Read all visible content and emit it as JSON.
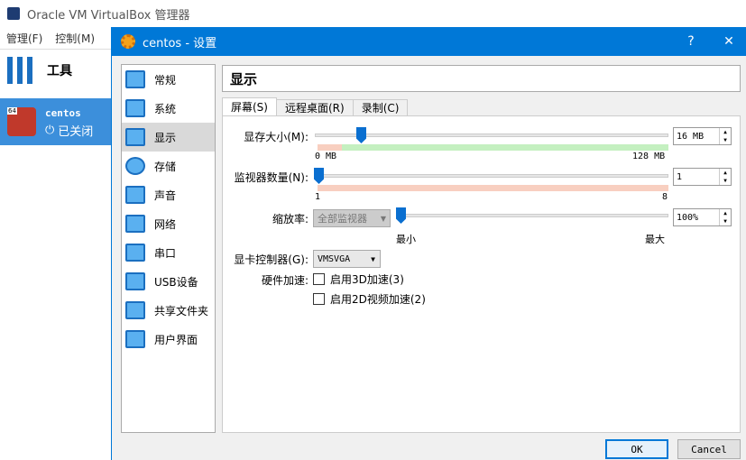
{
  "bg_window": {
    "title": "Oracle VM VirtualBox 管理器",
    "menu": [
      "管理(F)",
      "控制(M)"
    ],
    "tools_label": "工具",
    "vm": {
      "name": "centos",
      "badge": "64",
      "state": "已关闭"
    }
  },
  "dialog": {
    "title": "centos - 设置",
    "help": "?",
    "close": "✕",
    "sidebar": [
      {
        "label": "常规"
      },
      {
        "label": "系统"
      },
      {
        "label": "显示",
        "selected": true
      },
      {
        "label": "存储"
      },
      {
        "label": "声音"
      },
      {
        "label": "网络"
      },
      {
        "label": "串口"
      },
      {
        "label": "USB设备"
      },
      {
        "label": "共享文件夹"
      },
      {
        "label": "用户界面"
      }
    ],
    "header": "显示",
    "tabs": [
      "屏幕(S)",
      "远程桌面(R)",
      "录制(C)"
    ],
    "video_memory": {
      "label": "显存大小(M):",
      "value": "16 MB",
      "min": "0 MB",
      "max": "128 MB",
      "fraction": 0.125
    },
    "monitors": {
      "label": "监视器数量(N):",
      "value": "1",
      "min": "1",
      "max": "8",
      "fraction": 0
    },
    "scale": {
      "label": "缩放率:",
      "combo": "全部监视器",
      "value": "100%",
      "min": "最小",
      "max": "最大",
      "fraction": 0
    },
    "controller": {
      "label": "显卡控制器(G):",
      "value": "VMSVGA"
    },
    "accel": {
      "label": "硬件加速:",
      "opt3d": "启用3D加速(3)",
      "opt2d": "启用2D视频加速(2)"
    },
    "ok": "OK",
    "cancel": "Cancel"
  }
}
